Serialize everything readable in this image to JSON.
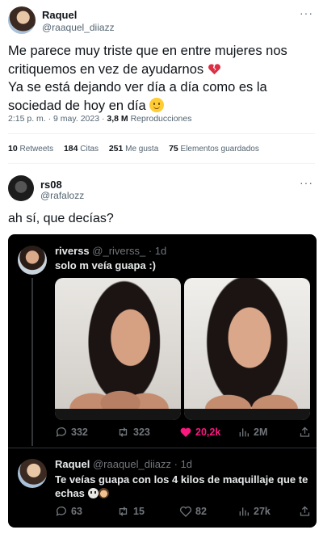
{
  "tweet1": {
    "name": "Raquel",
    "handle": "@raaquel_diiazz",
    "more": "···",
    "text_lines": [
      "Me parece muy triste que en entre mujeres nos",
      "critiquemos en vez de ayudarnos",
      "Ya se está dejando ver día a día como es la",
      "sociedad de hoy en día"
    ],
    "emojis": [
      "broken-heart",
      "slightly-smiling-face"
    ],
    "meta": {
      "time": "2:15 p. m.",
      "sep": " · ",
      "date": "9 may. 2023",
      "views_count": "3,8 M",
      "views_label": "Reproducciones"
    },
    "stats": [
      {
        "count": "10",
        "label": "Retweets"
      },
      {
        "count": "184",
        "label": "Citas"
      },
      {
        "count": "251",
        "label": "Me gusta"
      },
      {
        "count": "75",
        "label": "Elementos guardados"
      }
    ]
  },
  "tweet2": {
    "name": "rs08",
    "handle": "@rafalozz",
    "more": "···",
    "text": "ah sí, que decías?"
  },
  "embed": {
    "post1": {
      "name": "riverss",
      "handle": "@_riverss_",
      "dot": " · ",
      "age": "1d",
      "text": "solo m veía guapa :)",
      "actions": {
        "replies": "332",
        "reposts": "323",
        "likes": "20,2k",
        "views": "2M"
      }
    },
    "post2": {
      "name": "Raquel",
      "handle": "@raaquel_diiazz",
      "dot": " · ",
      "age": "1d",
      "text": "Te veías guapa con los 4 kilos de maquillaje que te echas",
      "emojis": [
        "skull",
        "woman-facepalming"
      ],
      "actions": {
        "replies": "63",
        "reposts": "15",
        "likes": "82",
        "views": "27k"
      }
    },
    "colors": {
      "background": "#000000",
      "like_active": "#f91880",
      "muted": "#71767b"
    }
  },
  "icons": [
    "more-icon",
    "reply-icon",
    "retweet-icon",
    "like-icon",
    "views-icon",
    "share-icon"
  ]
}
